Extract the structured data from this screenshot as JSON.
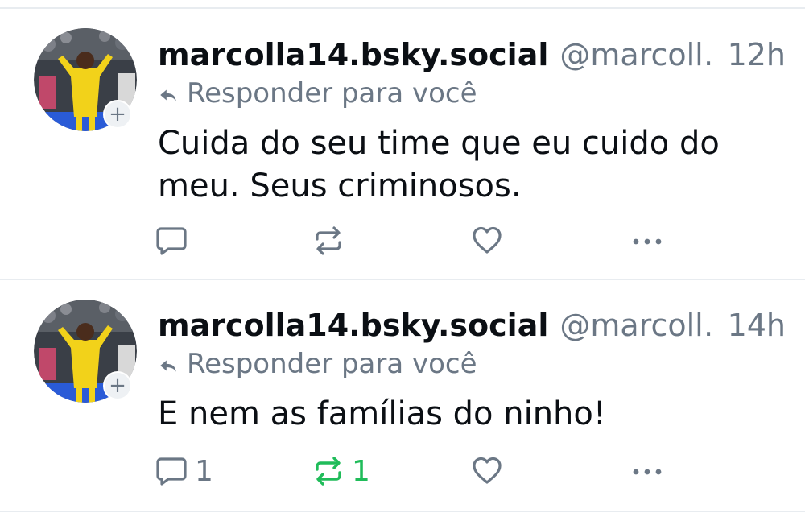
{
  "posts": [
    {
      "author_handle": "marcolla14.bsky.social",
      "author_at": "@marcoll…",
      "time": "12h",
      "reply_label": "Responder para você",
      "text_line1": "Cuida do seu time que eu cuido do",
      "text_line2": "meu. Seus criminosos.",
      "reply_count": "",
      "repost_count": "",
      "reposted": false
    },
    {
      "author_handle": "marcolla14.bsky.social",
      "author_at": "@marcoll…",
      "time": "14h",
      "reply_label": "Responder para você",
      "text_line1": "E nem as famílias do ninho!",
      "text_line2": "",
      "reply_count": "1",
      "repost_count": "1",
      "reposted": true
    }
  ],
  "colors": {
    "text": "#0b0f14",
    "muted": "#6b7785",
    "repost_active": "#20bc5a",
    "divider": "#e8ecf0"
  },
  "icons": {
    "reply": "speech-bubble-icon",
    "repost": "repost-arrows-icon",
    "like": "heart-icon",
    "more": "more-dots-icon",
    "reply_indicator": "reply-arrow-icon",
    "follow": "plus-icon"
  }
}
